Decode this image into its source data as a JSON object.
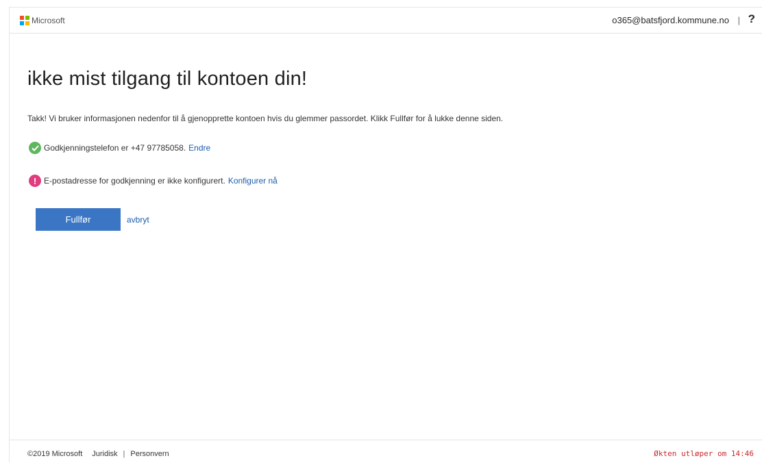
{
  "header": {
    "brand": "Microsoft",
    "account": "o365@batsfjord.kommune.no",
    "separator": "|",
    "help": "?"
  },
  "main": {
    "title": "ikke mist tilgang til kontoen din!",
    "intro": "Takk! Vi bruker informasjonen nedenfor til å gjenopprette kontoen hvis du glemmer passordet. Klikk Fullfør for å lukke denne siden.",
    "phone_status": {
      "text": "Godkjenningstelefon er +47 97785058.",
      "link": "Endre",
      "icon": "check-circle-icon",
      "color": "#5fb65f"
    },
    "email_status": {
      "text": "E-postadresse for godkjenning er ikke konfigurert.",
      "link": "Konfigurer nå",
      "icon": "warning-circle-icon",
      "icon_glyph": "!",
      "color": "#e03c7e"
    },
    "finish_button": "Fullfør",
    "cancel_link": "avbryt"
  },
  "footer": {
    "copyright": "©2019 Microsoft",
    "legal": "Juridisk",
    "separator": "|",
    "privacy": "Personvern",
    "session_timeout": "Økten utløper om 14:46"
  },
  "colors": {
    "accent": "#3a76c4",
    "link": "#1a5cab",
    "timeout": "#c8282d",
    "logo": [
      "#f25022",
      "#7fba00",
      "#00a4ef",
      "#ffb900"
    ]
  }
}
